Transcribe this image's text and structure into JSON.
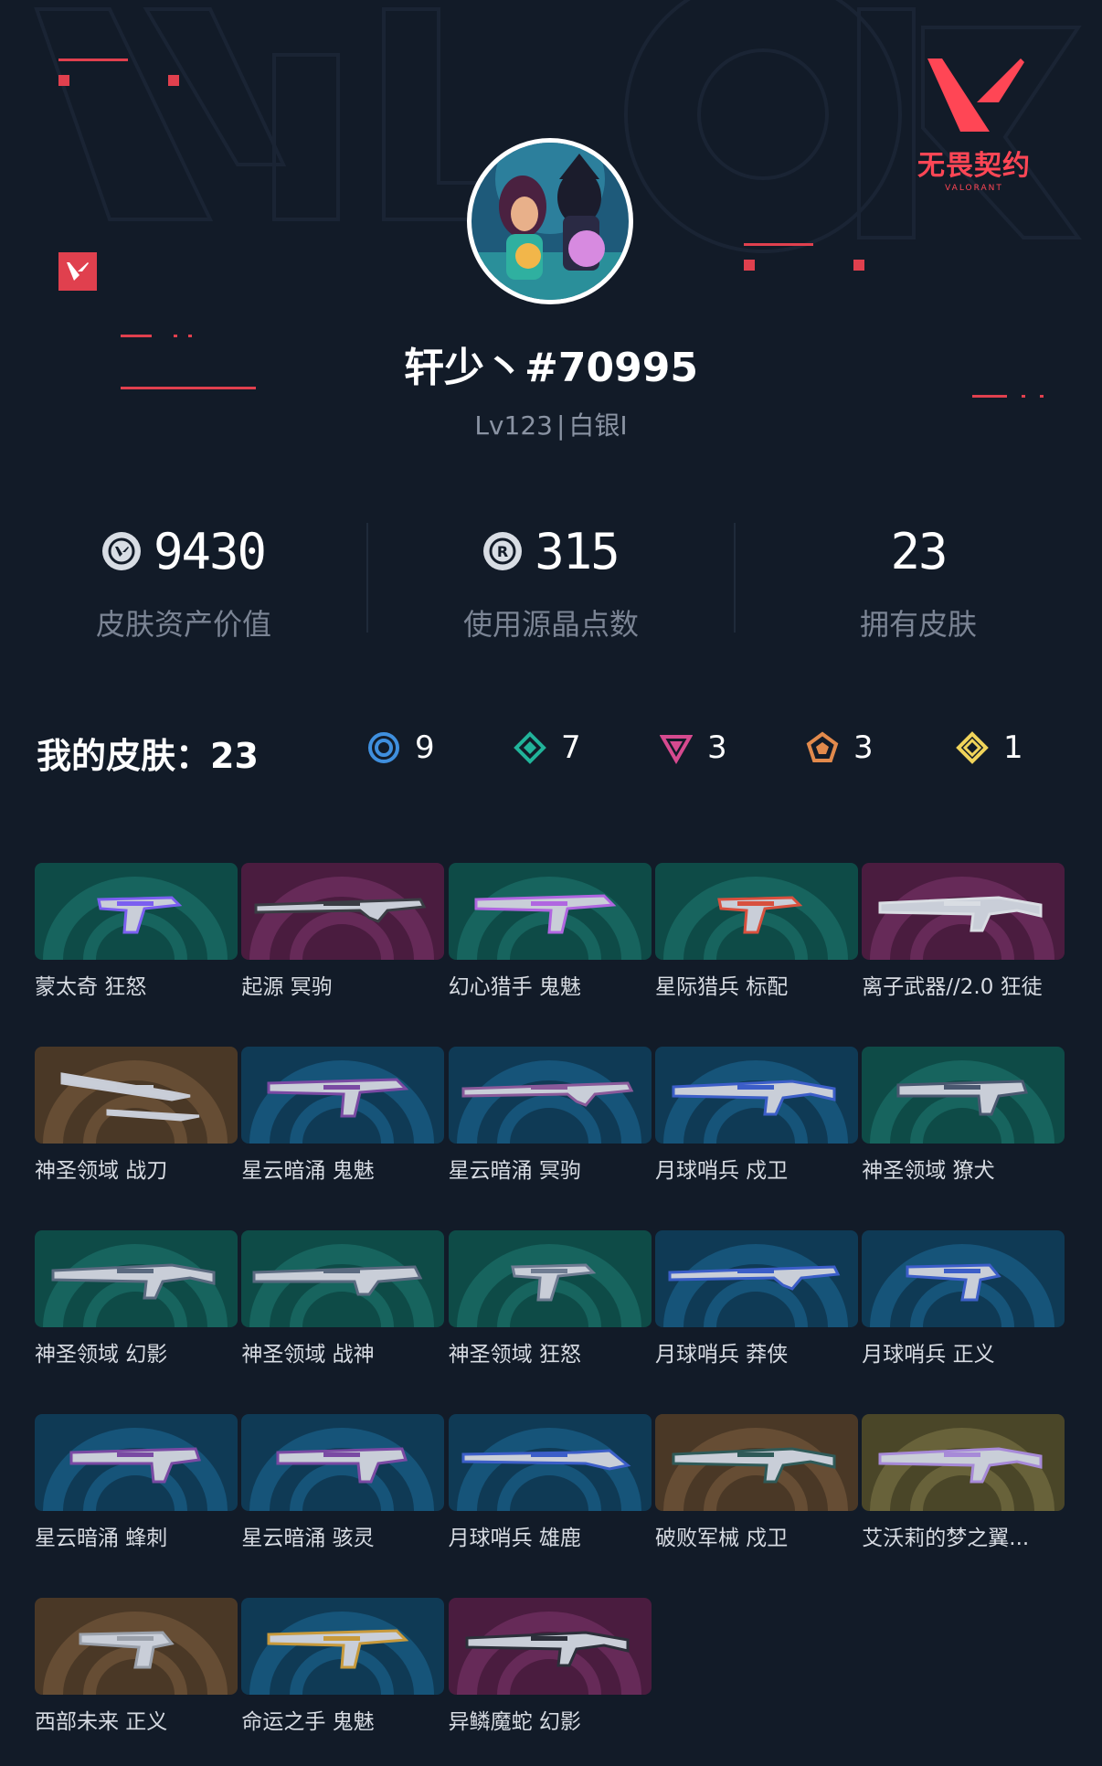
{
  "brand": {
    "cn": "无畏契约",
    "en": "VALORANT"
  },
  "profile": {
    "name": "轩少丶#70995",
    "level": "Lv123",
    "rank": "白银I",
    "avatar_icon": "avatar-image"
  },
  "stats": [
    {
      "value": "9430",
      "label": "皮肤资产价值",
      "icon": "valorant-points-icon"
    },
    {
      "value": "315",
      "label": "使用源晶点数",
      "icon": "radianite-points-icon"
    },
    {
      "value": "23",
      "label": "拥有皮肤",
      "icon": ""
    }
  ],
  "skins_summary": {
    "title": "我的皮肤：23",
    "tiers": [
      {
        "name": "select-tier",
        "count": "9",
        "color": "#3f8fde"
      },
      {
        "name": "deluxe-tier",
        "count": "7",
        "color": "#21b39a"
      },
      {
        "name": "premium-tier",
        "count": "3",
        "color": "#d64a8f"
      },
      {
        "name": "exclusive-tier",
        "count": "3",
        "color": "#e28a4c"
      },
      {
        "name": "ultra-tier",
        "count": "1",
        "color": "#f0d45a"
      }
    ]
  },
  "skins": [
    {
      "name": "蒙太奇 狂怒",
      "bg": "teal",
      "gun": "pistol",
      "accent": "#7b5ff0"
    },
    {
      "name": "起源 冥驹",
      "bg": "magenta",
      "gun": "sniper",
      "accent": "#3a3d44"
    },
    {
      "name": "幻心猎手 鬼魅",
      "bg": "teal",
      "gun": "pistol-long",
      "accent": "#b066e0"
    },
    {
      "name": "星际猎兵 标配",
      "bg": "teal",
      "gun": "pistol",
      "accent": "#d8503e"
    },
    {
      "name": "离子武器//2.0 狂徒",
      "bg": "magenta",
      "gun": "rifle",
      "accent": "#d9dde3"
    },
    {
      "name": "神圣领域 战刀",
      "bg": "brown",
      "gun": "knife",
      "accent": "#c8ccd6"
    },
    {
      "name": "星云暗涌 鬼魅",
      "bg": "blue",
      "gun": "pistol-long",
      "accent": "#7a4aa3"
    },
    {
      "name": "星云暗涌 冥驹",
      "bg": "blue",
      "gun": "sniper",
      "accent": "#8a5a9a"
    },
    {
      "name": "月球哨兵 戍卫",
      "bg": "blue",
      "gun": "rifle",
      "accent": "#3c5ec8"
    },
    {
      "name": "神圣领域 獠犬",
      "bg": "teal",
      "gun": "smg",
      "accent": "#4a5870"
    },
    {
      "name": "神圣领域 幻影",
      "bg": "teal",
      "gun": "rifle",
      "accent": "#5b6a80"
    },
    {
      "name": "神圣领域 战神",
      "bg": "teal",
      "gun": "lmg",
      "accent": "#5b6a80"
    },
    {
      "name": "神圣领域 狂怒",
      "bg": "teal",
      "gun": "pistol",
      "accent": "#6f7c92"
    },
    {
      "name": "月球哨兵 莽侠",
      "bg": "blue",
      "gun": "sniper",
      "accent": "#3c5ec8"
    },
    {
      "name": "月球哨兵 正义",
      "bg": "blue",
      "gun": "revolver",
      "accent": "#3c5ec8"
    },
    {
      "name": "星云暗涌 蜂刺",
      "bg": "blue",
      "gun": "smg",
      "accent": "#7a4aa3"
    },
    {
      "name": "星云暗涌 骇灵",
      "bg": "blue",
      "gun": "smg",
      "accent": "#7a4aa3"
    },
    {
      "name": "月球哨兵 雄鹿",
      "bg": "blue",
      "gun": "shotgun",
      "accent": "#3c5ec8"
    },
    {
      "name": "破败军械 戍卫",
      "bg": "brown",
      "gun": "rifle",
      "accent": "#2f5a58"
    },
    {
      "name": "艾沃莉的梦之翼...",
      "bg": "olive",
      "gun": "rifle",
      "accent": "#a78ad8"
    },
    {
      "name": "西部未来 正义",
      "bg": "brown",
      "gun": "revolver",
      "accent": "#9aa0aa"
    },
    {
      "name": "命运之手 鬼魅",
      "bg": "blue",
      "gun": "pistol-long",
      "accent": "#c89a3c"
    },
    {
      "name": "异鳞魔蛇 幻影",
      "bg": "magenta",
      "gun": "rifle",
      "accent": "#2c2f3a"
    }
  ],
  "colors": {
    "background": "#121b28",
    "accent_red": "#e0404e",
    "card_teal": "#0e4b47",
    "card_blue": "#0f3a55",
    "card_magenta": "#4a1c3f",
    "card_brown": "#4a3826",
    "card_olive": "#4a4628"
  }
}
